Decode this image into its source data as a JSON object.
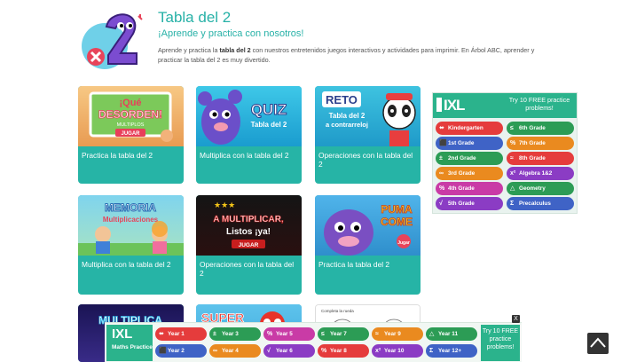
{
  "header": {
    "title": "Tabla del 2",
    "subtitle": "¡Aprende y practica con nosotros!",
    "desc_pre": "Aprende y practica la ",
    "desc_bold": "tabla del 2",
    "desc_post": " con nuestros entretenidos juegos interactivos y actividades para imprimir. En Árbol ABC, aprender y practicar la tabla del 2 es muy divertido."
  },
  "cards": [
    {
      "label": "Practica la tabla del 2",
      "art_text": "¡Qué DESORDEN! MULTIPLOS JUGAR",
      "art": "desorden"
    },
    {
      "label": "Multiplica con la tabla del 2",
      "art_text": "QUIZ Tabla del 2",
      "art": "quiz"
    },
    {
      "label": "Operaciones con la tabla del 2",
      "art_text": "RETO Tabla del 2 a contrarreloj",
      "art": "reto"
    },
    {
      "label": "Multiplica con la tabla del 2",
      "art_text": "MEMORIA Multiplicaciones",
      "art": "memoria"
    },
    {
      "label": "Operaciones con la tabla del 2",
      "art_text": "A MULTIPLICAR, Listos ¡ya! JUGAR",
      "art": "listos"
    },
    {
      "label": "Practica la tabla del 2",
      "art_text": "PUMA COME Jugar",
      "art": "puma"
    }
  ],
  "partial_cards": [
    {
      "art_text": "MULTIPLICA con las TABLAS"
    },
    {
      "art_text": "SUPER"
    },
    {
      "art_text": "Completa la rueda"
    }
  ],
  "ad_right": {
    "brand": "IXL",
    "cta": "Try 10 FREE practice problems!",
    "pills": [
      {
        "label": "Kindergarten",
        "sym": "⬌",
        "color": "#e53c3c"
      },
      {
        "label": "6th Grade",
        "sym": "≤",
        "color": "#2c9c55"
      },
      {
        "label": "1st Grade",
        "sym": "⬛",
        "color": "#3f63c6"
      },
      {
        "label": "7th Grade",
        "sym": "%",
        "color": "#ea8a1f"
      },
      {
        "label": "2nd Grade",
        "sym": "±",
        "color": "#2c9c55"
      },
      {
        "label": "8th Grade",
        "sym": "≈",
        "color": "#e53c3c"
      },
      {
        "label": "3rd Grade",
        "sym": "∞",
        "color": "#ea8a1f"
      },
      {
        "label": "Algebra 1&2",
        "sym": "x²",
        "color": "#8b3cc4"
      },
      {
        "label": "4th Grade",
        "sym": "%",
        "color": "#c93ba6"
      },
      {
        "label": "Geometry",
        "sym": "△",
        "color": "#2c9c55"
      },
      {
        "label": "5th Grade",
        "sym": "√",
        "color": "#8b3cc4"
      },
      {
        "label": "Precalculus",
        "sym": "Σ",
        "color": "#3f63c6"
      }
    ]
  },
  "ad_bottom": {
    "brand": "IXL",
    "sub": "Maths Practice",
    "cta": "Try 10 FREE practice problems!",
    "close": "X",
    "pills": [
      {
        "label": "Year 1",
        "sym": "⬌",
        "color": "#e53c3c"
      },
      {
        "label": "Year 3",
        "sym": "±",
        "color": "#2c9c55"
      },
      {
        "label": "Year 5",
        "sym": "%",
        "color": "#c93ba6"
      },
      {
        "label": "Year 7",
        "sym": "≤",
        "color": "#2c9c55"
      },
      {
        "label": "Year 9",
        "sym": "≈",
        "color": "#ea8a1f"
      },
      {
        "label": "Year 11",
        "sym": "△",
        "color": "#2c9c55"
      },
      {
        "label": "Year 2",
        "sym": "⬛",
        "color": "#3f63c6"
      },
      {
        "label": "Year 4",
        "sym": "∞",
        "color": "#ea8a1f"
      },
      {
        "label": "Year 6",
        "sym": "√",
        "color": "#8b3cc4"
      },
      {
        "label": "Year 8",
        "sym": "%",
        "color": "#e53c3c"
      },
      {
        "label": "Year 10",
        "sym": "x²",
        "color": "#8b3cc4"
      },
      {
        "label": "Year 12+",
        "sym": "Σ",
        "color": "#3f63c6"
      }
    ]
  }
}
